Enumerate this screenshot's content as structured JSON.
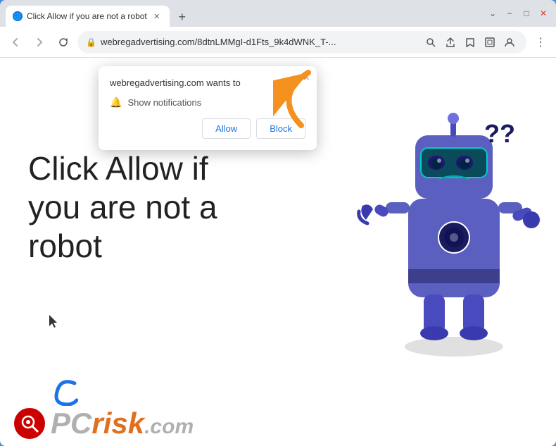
{
  "browser": {
    "tab": {
      "title": "Click Allow if you are not a robot",
      "favicon_label": "globe-icon"
    },
    "new_tab_label": "+",
    "window_controls": {
      "chevron_down": "⌄",
      "minimize": "−",
      "maximize": "□",
      "close": "✕"
    },
    "nav": {
      "back_label": "←",
      "forward_label": "→",
      "reload_label": "↻"
    },
    "address_bar": {
      "url": "webregadvertising.com/8dtnLMMgI-d1Fts_9k4dWNK_T-...",
      "lock_icon": "🔒",
      "search_icon": "🔍",
      "share_icon": "⬆",
      "star_icon": "☆",
      "extension_icon": "⊡",
      "account_icon": "👤",
      "menu_icon": "⋮"
    }
  },
  "notification_popup": {
    "header_text": "webregadvertising.com wants to",
    "close_label": "×",
    "notification_row_text": "Show notifications",
    "allow_label": "Allow",
    "block_label": "Block"
  },
  "page": {
    "main_text": "Click Allow if you are not a robot"
  },
  "pcrisk": {
    "logo_icon": "🔍",
    "text": "PC",
    "risk_text": "risk",
    "com_text": ".com"
  },
  "colors": {
    "accent_blue": "#1a73e8",
    "background_blue": "#4a90d9",
    "robot_blue": "#5b5fbf",
    "orange_arrow": "#f5a623"
  }
}
